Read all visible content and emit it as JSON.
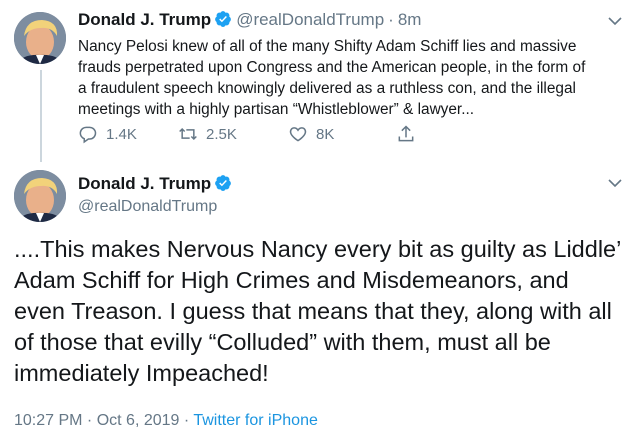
{
  "tweet1": {
    "author_name": "Donald J. Trump",
    "handle": "@realDonaldTrump",
    "separator": "·",
    "time": "8m",
    "text": "Nancy Pelosi knew of all of the many Shifty Adam Schiff lies and massive frauds perpetrated upon Congress and the American people, in the form of a fraudulent speech knowingly delivered as a ruthless con, and the illegal meetings with a highly partisan “Whistleblower” & lawyer...",
    "actions": {
      "reply_count": "1.4K",
      "retweet_count": "2.5K",
      "like_count": "8K"
    }
  },
  "tweet2": {
    "author_name": "Donald J. Trump",
    "handle": "@realDonaldTrump",
    "text": "....This makes Nervous Nancy every bit as guilty as Liddle’ Adam Schiff for High Crimes and Misdemeanors, and even Treason. I guess that means that they, along with all of those that evilly “Colluded” with them, must all be immediately Impeached!",
    "timestamp": "10:27 PM · Oct 6, 2019 · ",
    "source": "Twitter for iPhone"
  },
  "colors": {
    "verified_blue": "#1da1f2",
    "link_blue": "#1b95e0",
    "secondary_gray": "#657786",
    "text_dark": "#14171a"
  },
  "icons": [
    "verified-badge-icon",
    "chevron-down-icon",
    "reply-icon",
    "retweet-icon",
    "like-icon",
    "share-icon"
  ]
}
